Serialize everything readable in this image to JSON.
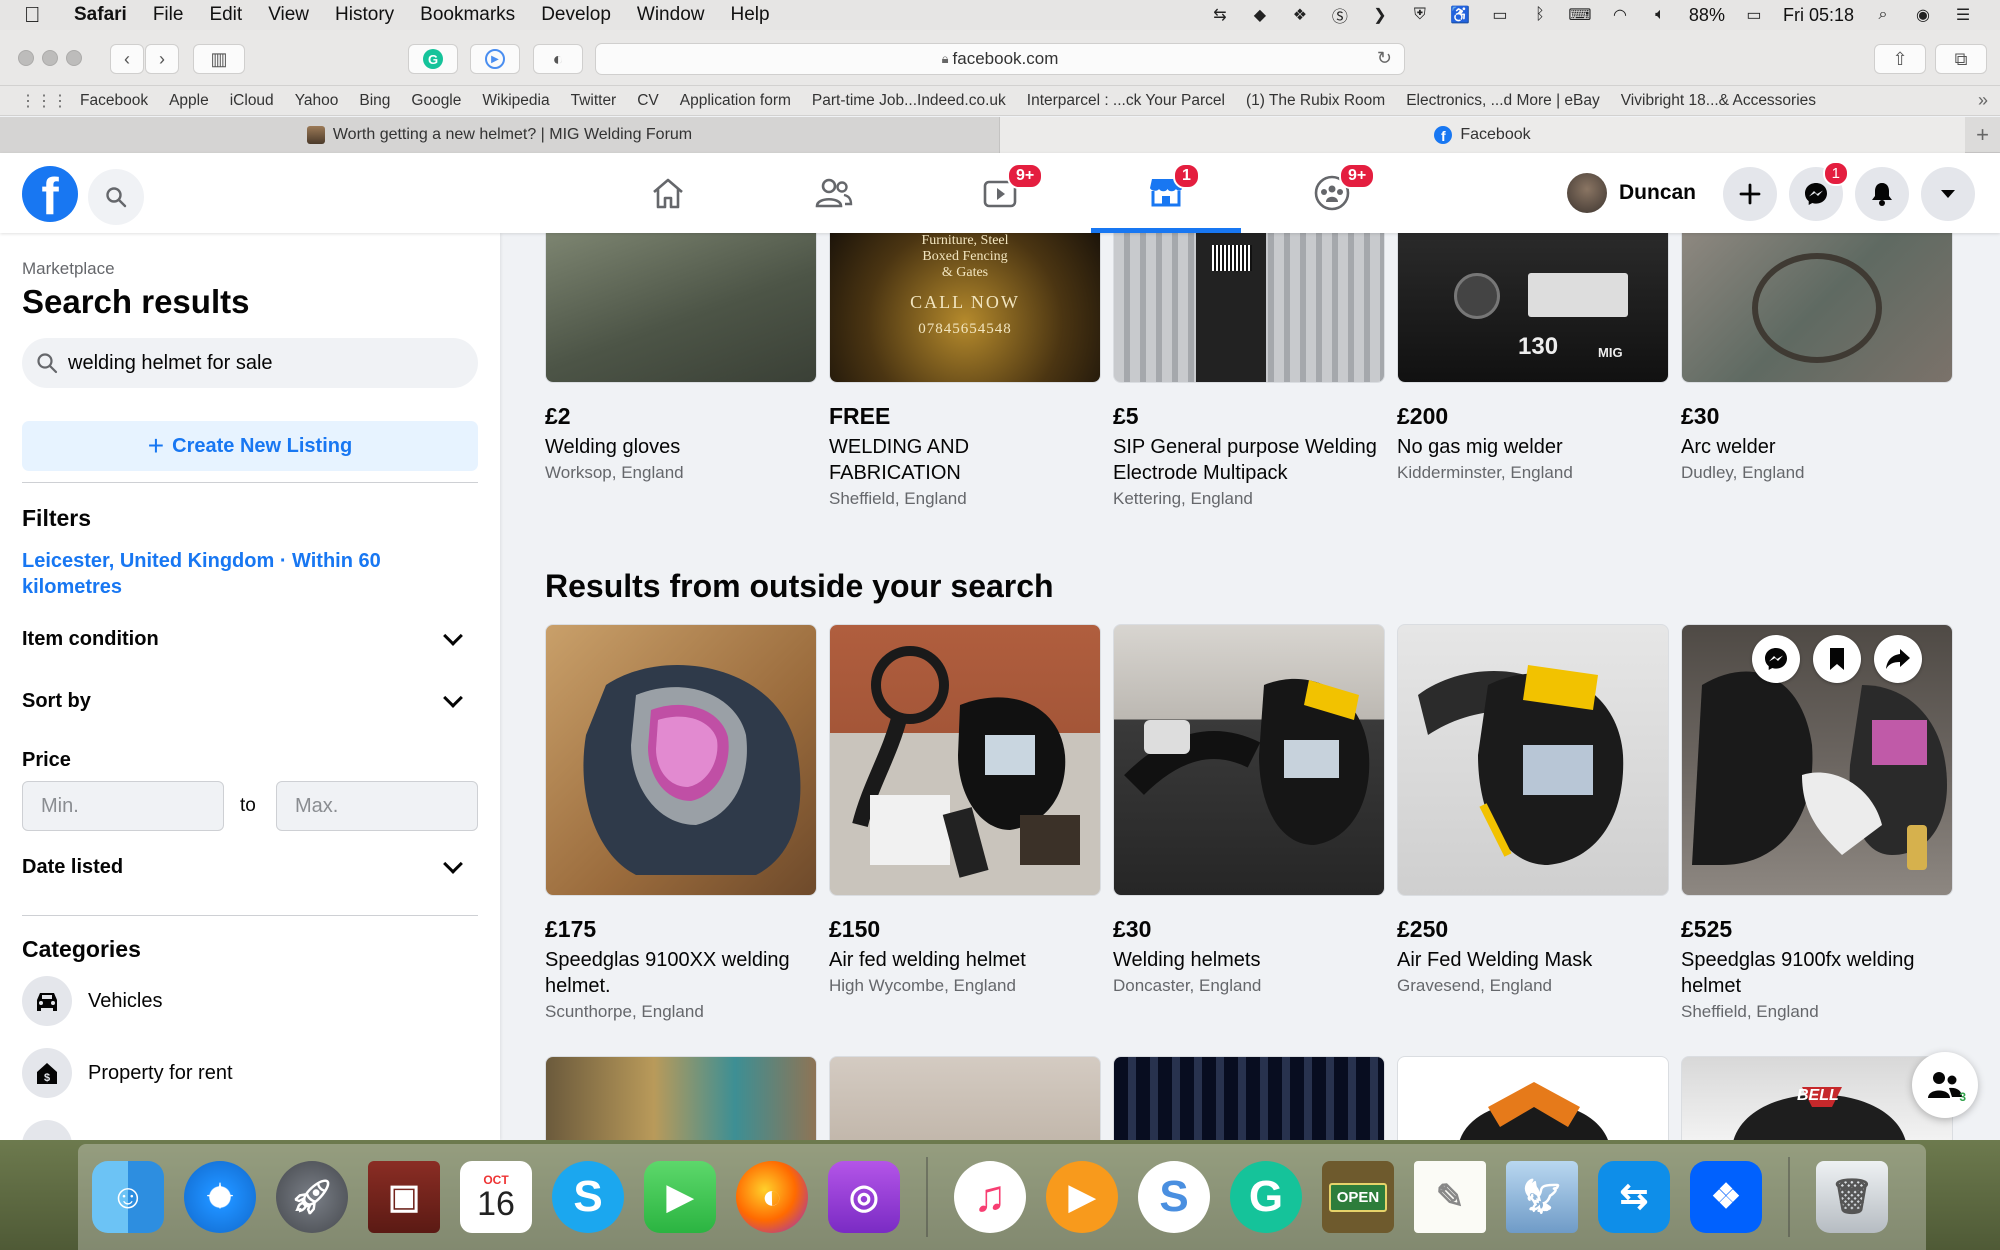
{
  "menubar": {
    "app_name": "Safari",
    "menus": [
      "File",
      "Edit",
      "View",
      "History",
      "Bookmarks",
      "Develop",
      "Window",
      "Help"
    ],
    "battery": "88%",
    "clock": "Fri 05:18"
  },
  "safari": {
    "url": "facebook.com",
    "bookmarks": [
      "Facebook",
      "Apple",
      "iCloud",
      "Yahoo",
      "Bing",
      "Google",
      "Wikipedia",
      "Twitter",
      "CV",
      "Application form",
      "Part-time Job...Indeed.co.uk",
      "Interparcel : ...ck Your Parcel",
      "(1) The Rubix Room",
      "Electronics, ...d More | eBay",
      "Vivibright 18...& Accessories"
    ],
    "tabs": [
      {
        "title": "Worth getting a new helmet? | MIG Welding Forum",
        "active": false
      },
      {
        "title": "Facebook",
        "active": true
      }
    ]
  },
  "fbnav": {
    "watch_badge": "9+",
    "marketplace_badge": "1",
    "groups_badge": "9+",
    "user_name": "Duncan",
    "messenger_badge": "1"
  },
  "sidebar": {
    "breadcrumb": "Marketplace",
    "title": "Search results",
    "search_value": "welding helmet for sale",
    "create_label": "Create New Listing",
    "filters_heading": "Filters",
    "location": "Leicester, United Kingdom · Within 60 kilometres",
    "item_condition": "Item condition",
    "sort_by": "Sort by",
    "price_heading": "Price",
    "price_min_placeholder": "Min.",
    "price_to": "to",
    "price_max_placeholder": "Max.",
    "date_listed": "Date listed",
    "categories_heading": "Categories",
    "categories": [
      "Vehicles",
      "Property for rent"
    ]
  },
  "listings_top": [
    {
      "price": "£2",
      "title": "Welding gloves",
      "location": "Worksop, England"
    },
    {
      "price": "FREE",
      "title": "WELDING AND FABRICATION",
      "location": "Sheffield, England",
      "image_text_1": "Furniture, Steel",
      "image_text_2": "Boxed Fencing",
      "image_text_3": "& Gates",
      "image_text_4": "CALL NOW",
      "image_text_5": "07845654548"
    },
    {
      "price": "£5",
      "title": "SIP General purpose Welding Electrode Multipack",
      "location": "Kettering, England"
    },
    {
      "price": "£200",
      "title": "No gas mig welder",
      "location": "Kidderminster, England",
      "image_text_1": "130",
      "image_text_2": "MIG"
    },
    {
      "price": "£30",
      "title": "Arc welder",
      "location": "Dudley, England"
    }
  ],
  "section_heading": "Results from outside your search",
  "listings_outside": [
    {
      "price": "£175",
      "title": "Speedglas 9100XX welding helmet.",
      "location": "Scunthorpe, England"
    },
    {
      "price": "£150",
      "title": "Air fed welding helmet",
      "location": "High Wycombe, England"
    },
    {
      "price": "£30",
      "title": "Welding helmets",
      "location": "Doncaster, England"
    },
    {
      "price": "£250",
      "title": "Air Fed Welding Mask",
      "location": "Gravesend, England"
    },
    {
      "price": "£525",
      "title": "Speedglas 9100fx welding helmet",
      "location": "Sheffield, England"
    }
  ],
  "bottom_row_image_text": "BELL",
  "contacts_count": "3",
  "dock": {
    "calendar_month": "OCT",
    "calendar_day": "16",
    "open_sign": "OPEN"
  },
  "colors": {
    "fb_blue": "#1877f2",
    "badge_red": "#e41e3f"
  }
}
